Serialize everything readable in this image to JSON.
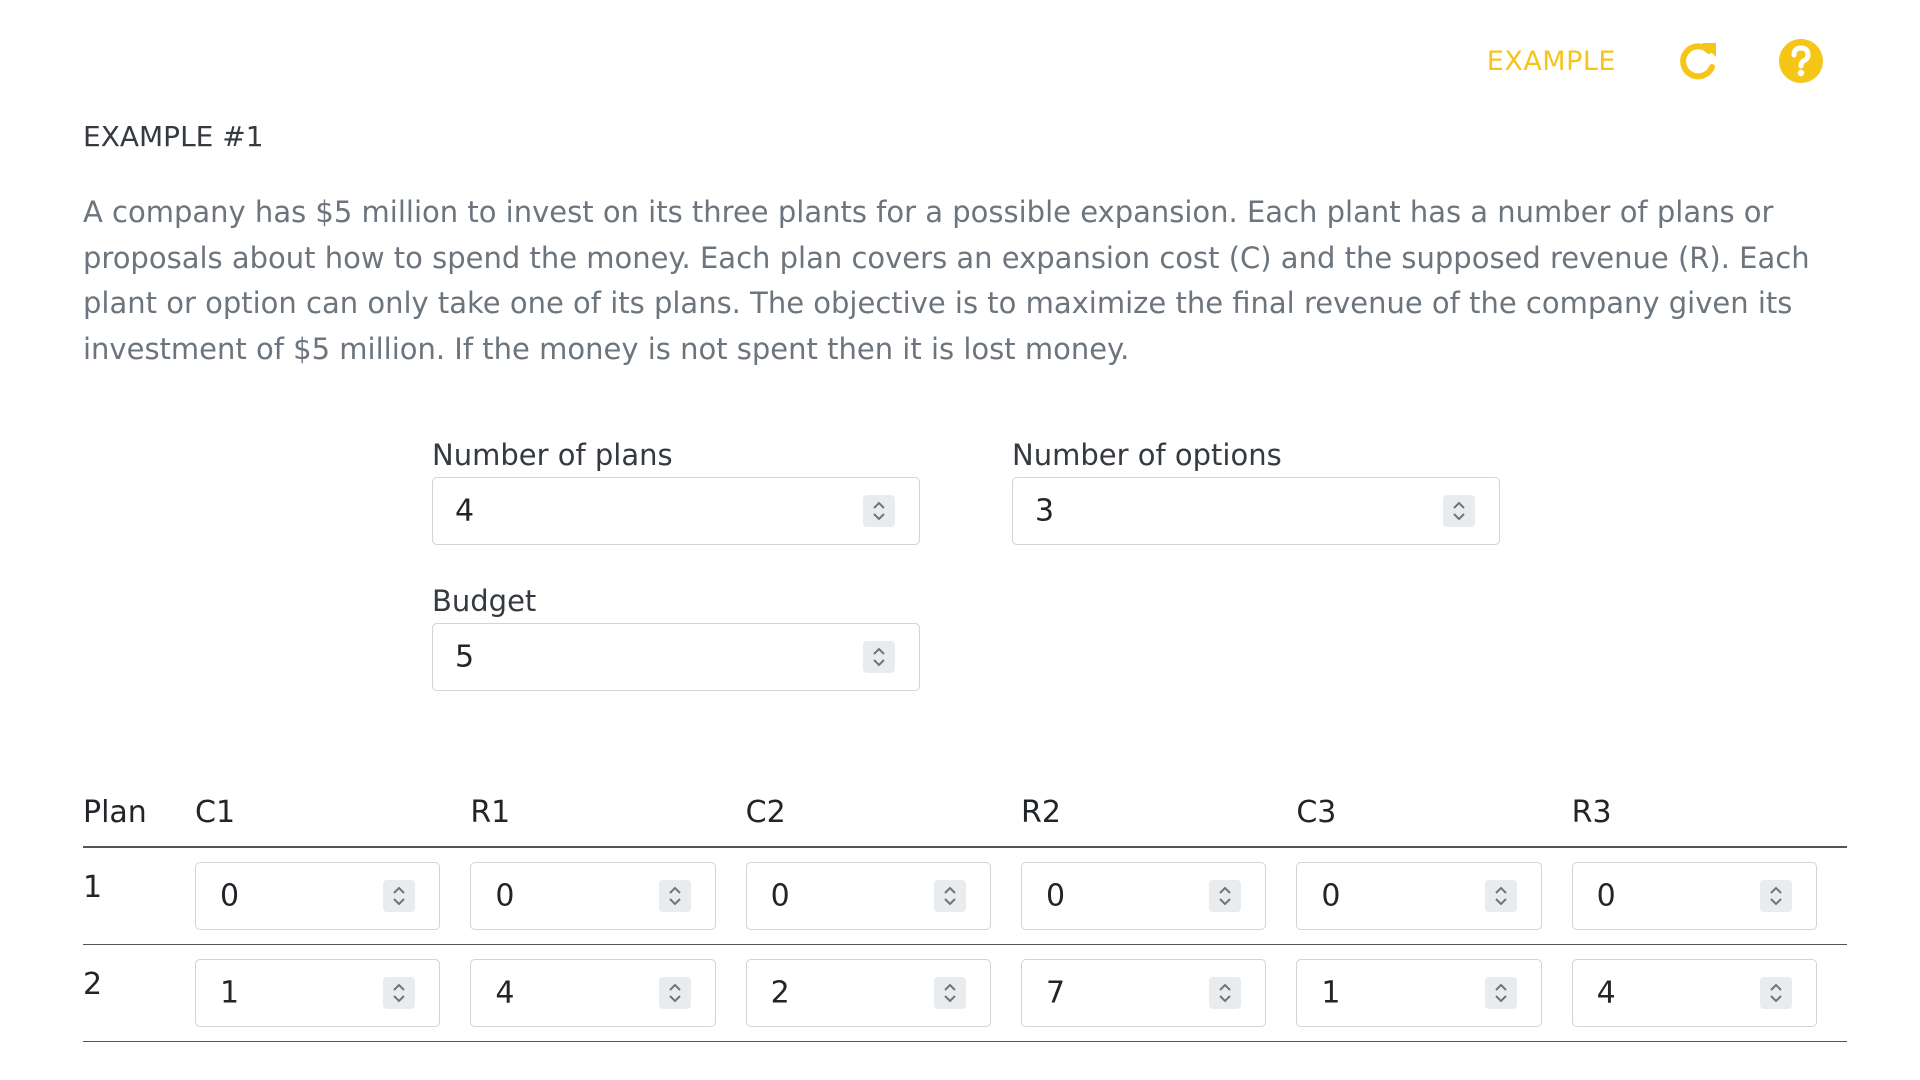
{
  "header": {
    "example_label": "EXAMPLE",
    "reload_icon": "redo-icon",
    "help_icon": "question-circle-icon",
    "accent_color": "#f5c518"
  },
  "title": "EXAMPLE #1",
  "description": "A company has $5 million to invest on its three plants for a possible expansion. Each plant has a number of plans or proposals about how to spend the money. Each plan covers an expansion cost (C) and the supposed revenue (R). Each plant or option can only take one of its plans. The objective is to maximize the final revenue of the company given its investment of $5 million. If the money is not spent then it is lost money.",
  "form": {
    "plans": {
      "label": "Number of plans",
      "value": "4"
    },
    "options": {
      "label": "Number of options",
      "value": "3"
    },
    "budget": {
      "label": "Budget",
      "value": "5"
    }
  },
  "table": {
    "headers": [
      "Plan",
      "C1",
      "R1",
      "C2",
      "R2",
      "C3",
      "R3"
    ],
    "rows": [
      {
        "plan": "1",
        "values": [
          "0",
          "0",
          "0",
          "0",
          "0",
          "0"
        ]
      },
      {
        "plan": "2",
        "values": [
          "1",
          "4",
          "2",
          "7",
          "1",
          "4"
        ]
      }
    ]
  }
}
